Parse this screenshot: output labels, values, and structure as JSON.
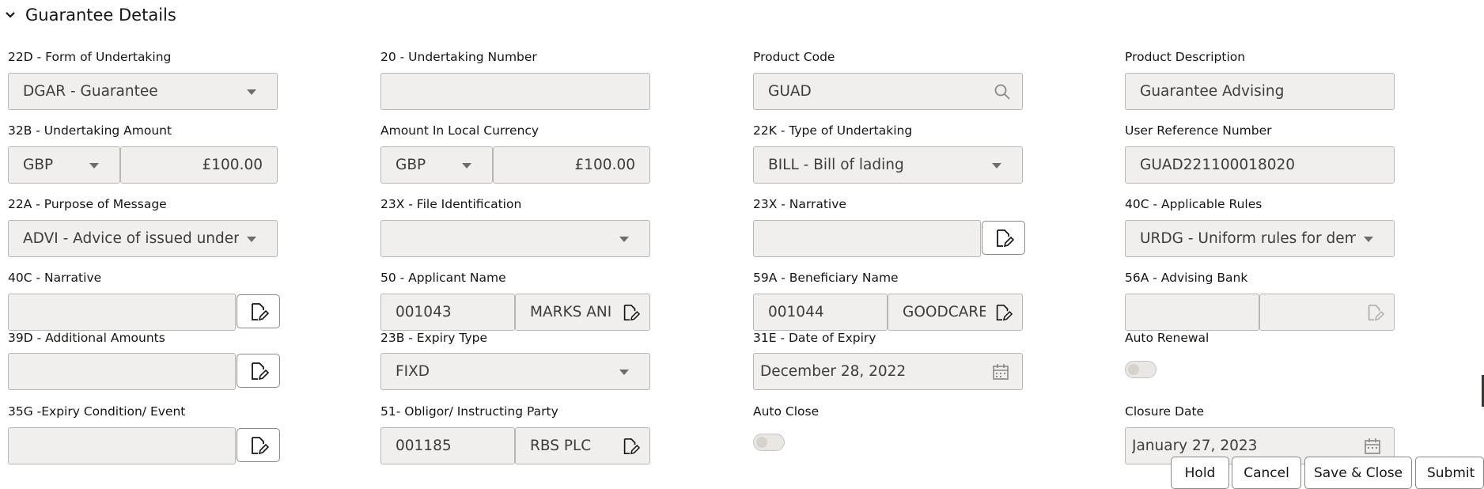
{
  "section": {
    "title": "Guarantee Details",
    "icon": "chevron-down-icon"
  },
  "fields": {
    "form_of_undertaking": {
      "label": "22D - Form of Undertaking",
      "value": "DGAR - Guarantee"
    },
    "undertaking_number": {
      "label": "20 - Undertaking Number",
      "value": ""
    },
    "product_code": {
      "label": "Product Code",
      "value": "GUAD"
    },
    "product_description": {
      "label": "Product Description",
      "value": "Guarantee Advising"
    },
    "undertaking_amount": {
      "label": "32B - Undertaking Amount",
      "currency": "GBP",
      "amount": "£100.00"
    },
    "amount_local": {
      "label": "Amount In Local Currency",
      "currency": "GBP",
      "amount": "£100.00"
    },
    "type_of_undertaking": {
      "label": "22K - Type of Undertaking",
      "value": "BILL - Bill of lading"
    },
    "user_reference": {
      "label": "User Reference Number",
      "value": "GUAD221100018020"
    },
    "purpose_of_message": {
      "label": "22A - Purpose of Message",
      "value": "ADVI - Advice of issued undert"
    },
    "file_identification": {
      "label": "23X - File Identification",
      "value": ""
    },
    "narrative_23x": {
      "label": "23X - Narrative",
      "value": ""
    },
    "applicable_rules": {
      "label": "40C - Applicable Rules",
      "value": "URDG - Uniform rules for dema"
    },
    "narrative_40c": {
      "label": "40C - Narrative",
      "value": ""
    },
    "applicant_name": {
      "label": "50 - Applicant Name",
      "id": "001043",
      "name": "MARKS ANI"
    },
    "beneficiary_name": {
      "label": "59A - Beneficiary Name",
      "id": "001044",
      "name": "GOODCARE"
    },
    "advising_bank": {
      "label": "56A - Advising Bank",
      "id": "",
      "name": ""
    },
    "additional_amounts": {
      "label": "39D - Additional Amounts",
      "value": ""
    },
    "expiry_type": {
      "label": "23B - Expiry Type",
      "value": "FIXD"
    },
    "date_of_expiry": {
      "label": "31E - Date of Expiry",
      "value": "December 28, 2022"
    },
    "auto_renewal": {
      "label": "Auto Renewal",
      "on": false
    },
    "expiry_condition": {
      "label": "35G -Expiry Condition/ Event",
      "value": ""
    },
    "obligor": {
      "label": "51- Obligor/ Instructing Party",
      "id": "001185",
      "name": "RBS PLC"
    },
    "auto_close": {
      "label": "Auto Close",
      "on": false
    },
    "closure_date": {
      "label": "Closure Date",
      "value": "January 27, 2023"
    }
  },
  "footer": {
    "hold": "Hold",
    "cancel": "Cancel",
    "save_close": "Save & Close",
    "submit": "Submit"
  },
  "icons": {
    "dropdown": "chevron-down-icon",
    "search": "search-icon",
    "calendar": "calendar-icon",
    "edit": "edit-document-icon"
  },
  "colors": {
    "field_bg": "#f1efed",
    "field_border": "#b9b6b1",
    "text": "#161513"
  }
}
